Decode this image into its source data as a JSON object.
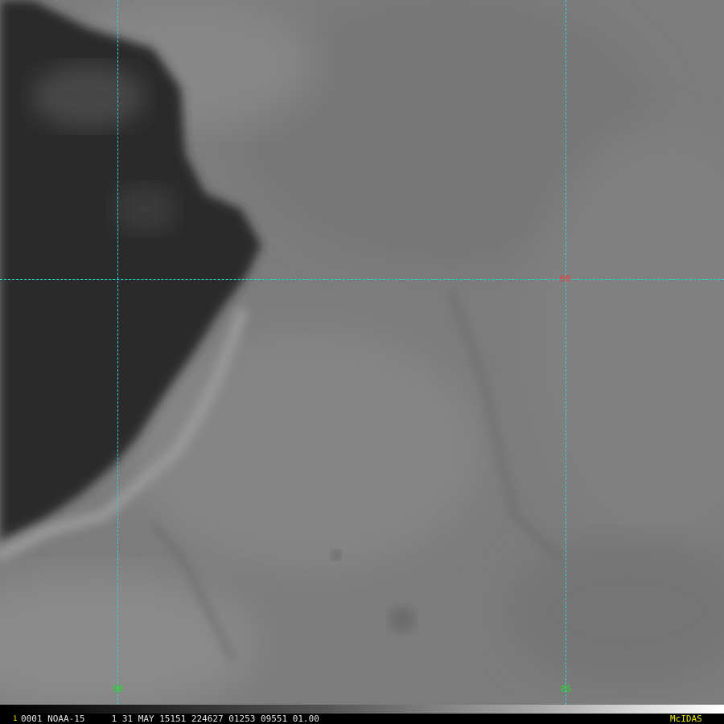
{
  "image": {
    "description_colors": {
      "land": "#7b7b7b",
      "water": "#2e2e2e",
      "grid": "#22d8d8",
      "lon_label": "#22dd22",
      "lat_label": "#ff3030"
    }
  },
  "grid": {
    "longitudes": [
      {
        "label": "90"
      },
      {
        "label": "85"
      }
    ],
    "latitudes": [
      {
        "label": "60"
      }
    ]
  },
  "status_bar": {
    "frame_number": "1",
    "text": "0001 NOAA-15     1 31 MAY 15151 224627 01253 09551 01.00",
    "brand": "McIDAS"
  }
}
